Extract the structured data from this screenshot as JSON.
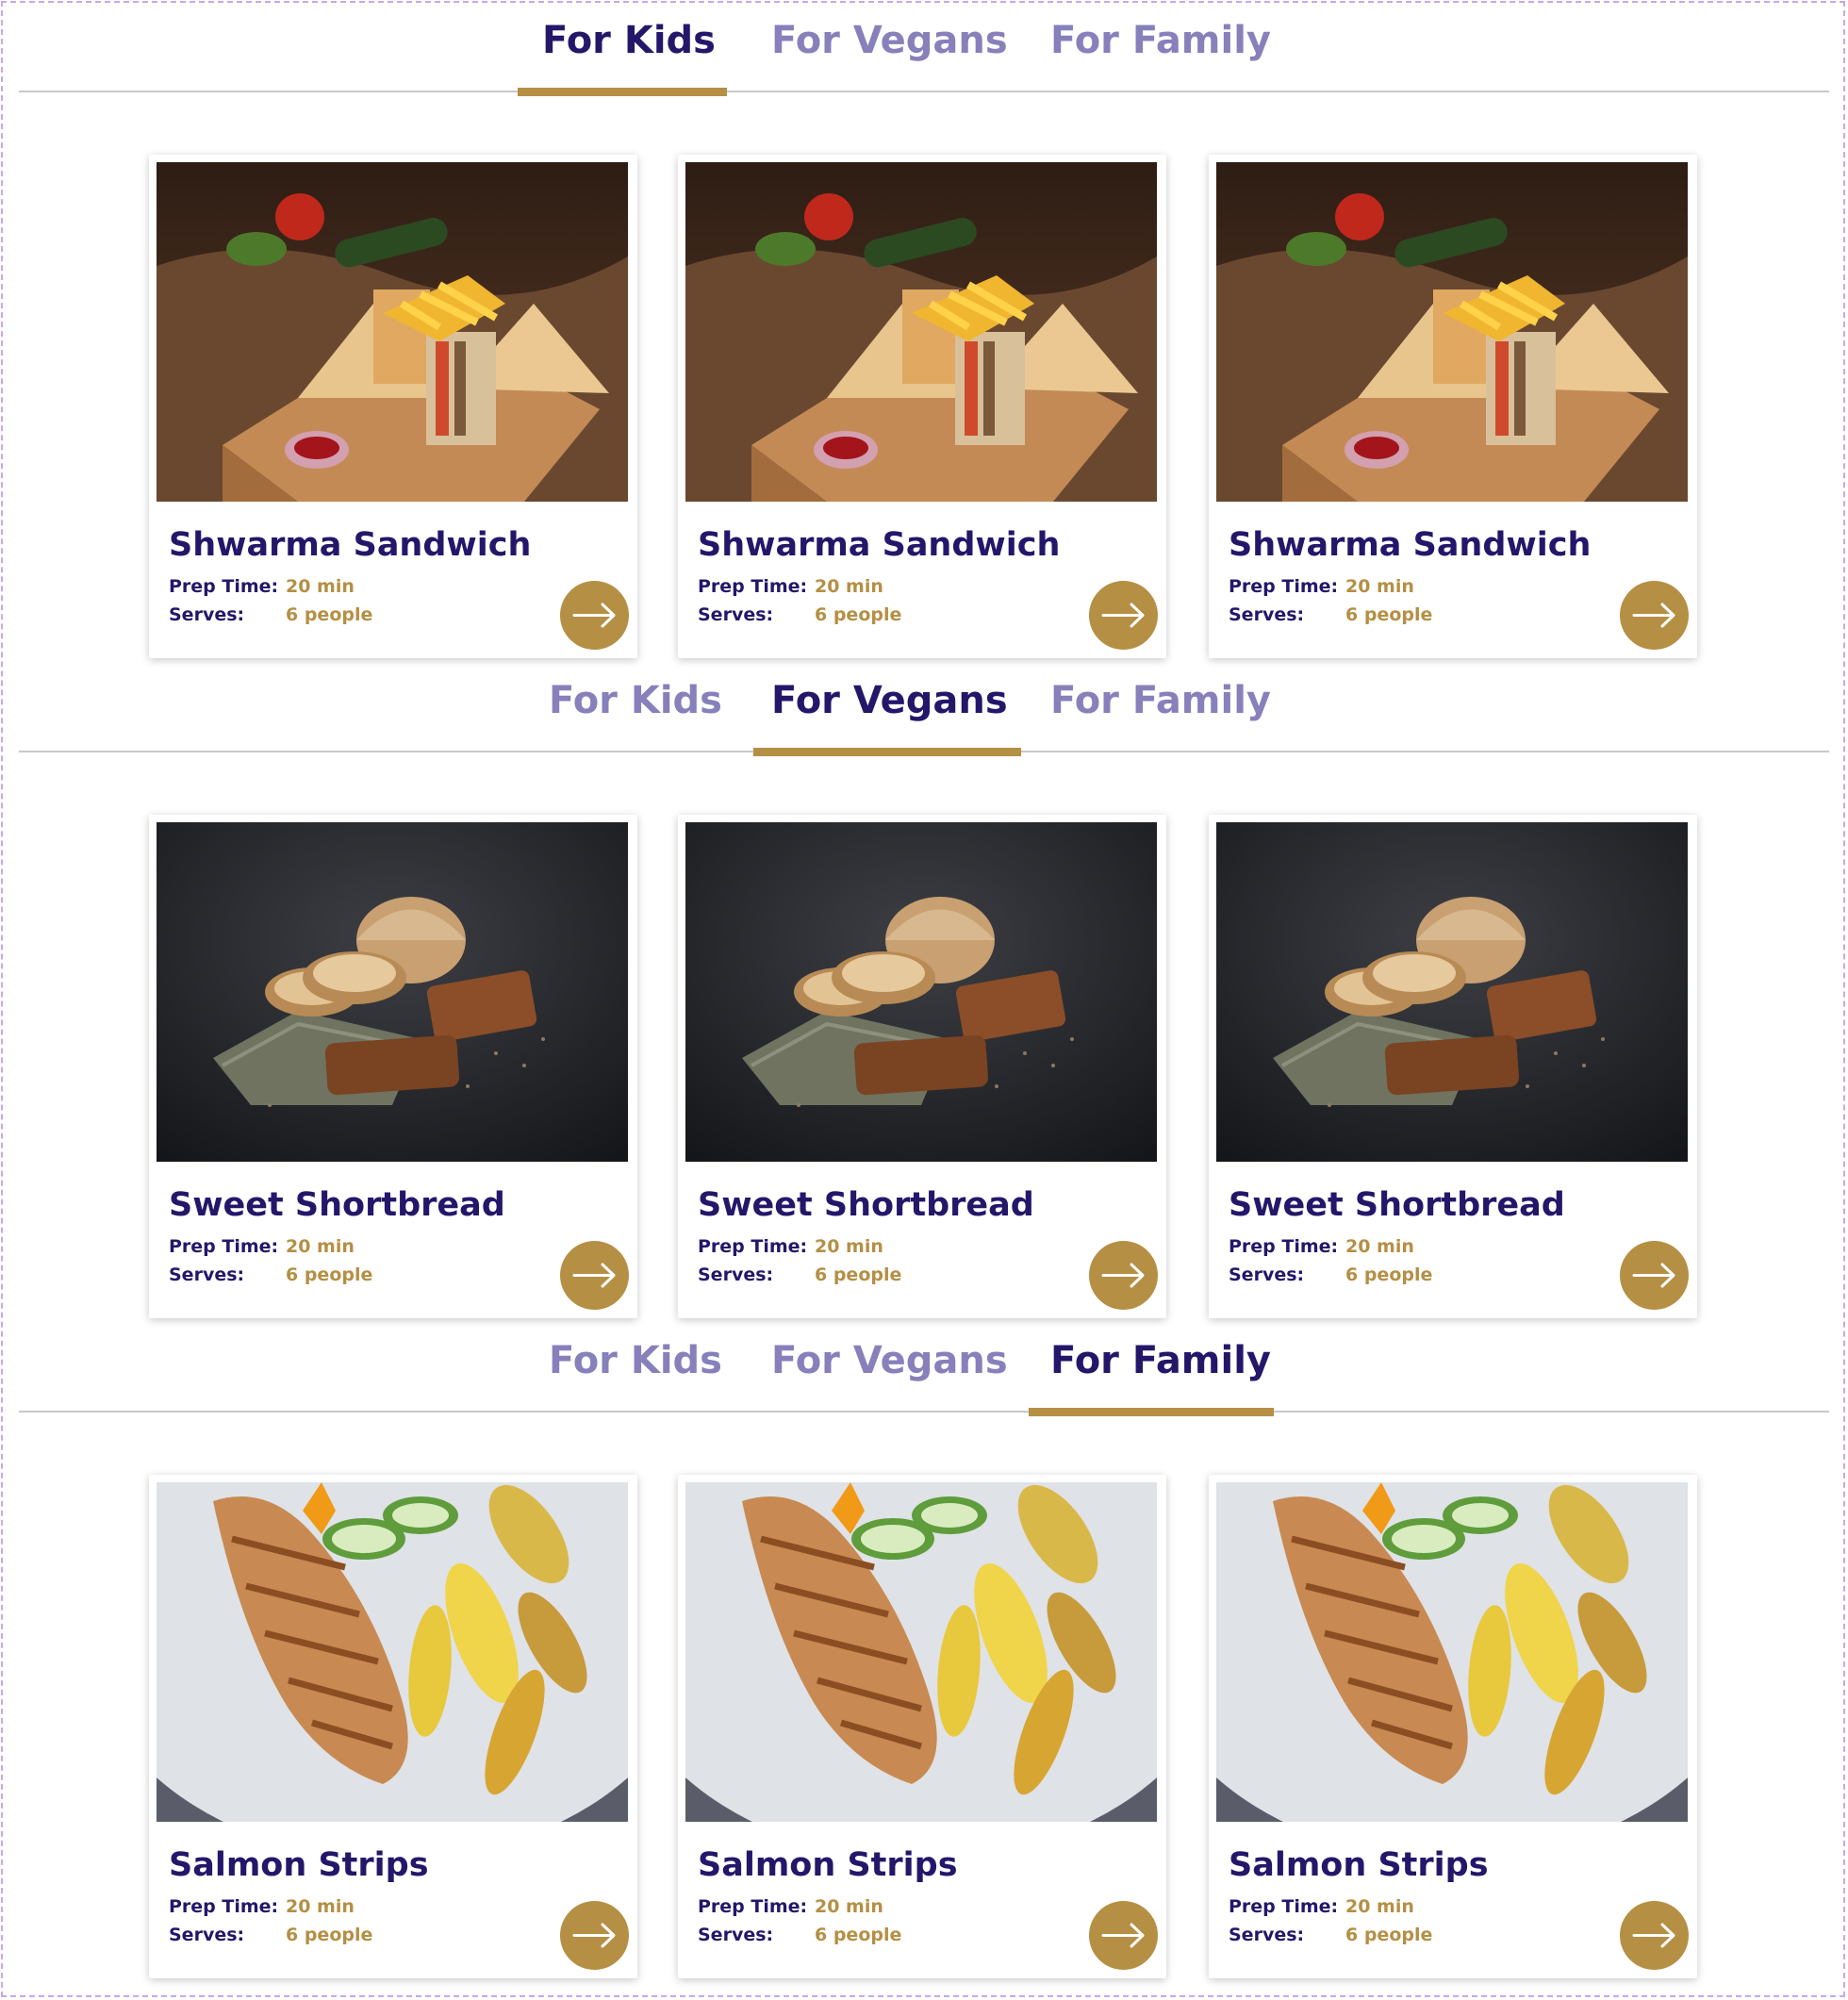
{
  "sections": [
    {
      "tabs": [
        {
          "label": "For Kids",
          "active": true
        },
        {
          "label": "For Vegans",
          "active": false
        },
        {
          "label": "For Family",
          "active": false
        }
      ],
      "cards": [
        {
          "title": "Shwarma Sandwich",
          "prep_label": "Prep Time:",
          "prep_value": "20 min",
          "serves_label": "Serves:",
          "serves_value": "6 people",
          "image": "sandwich-photo"
        },
        {
          "title": "Shwarma Sandwich",
          "prep_label": "Prep Time:",
          "prep_value": "20 min",
          "serves_label": "Serves:",
          "serves_value": "6 people",
          "image": "sandwich-photo"
        },
        {
          "title": "Shwarma Sandwich",
          "prep_label": "Prep Time:",
          "prep_value": "20 min",
          "serves_label": "Serves:",
          "serves_value": "6 people",
          "image": "sandwich-photo"
        }
      ]
    },
    {
      "tabs": [
        {
          "label": "For Kids",
          "active": false
        },
        {
          "label": "For Vegans",
          "active": true
        },
        {
          "label": "For Family",
          "active": false
        }
      ],
      "cards": [
        {
          "title": "Sweet Shortbread",
          "prep_label": "Prep Time:",
          "prep_value": "20 min",
          "serves_label": "Serves:",
          "serves_value": "6 people",
          "image": "bread-photo"
        },
        {
          "title": "Sweet Shortbread",
          "prep_label": "Prep Time:",
          "prep_value": "20 min",
          "serves_label": "Serves:",
          "serves_value": "6 people",
          "image": "bread-photo"
        },
        {
          "title": "Sweet Shortbread",
          "prep_label": "Prep Time:",
          "prep_value": "20 min",
          "serves_label": "Serves:",
          "serves_value": "6 people",
          "image": "bread-photo"
        }
      ]
    },
    {
      "tabs": [
        {
          "label": "For Kids",
          "active": false
        },
        {
          "label": "For Vegans",
          "active": false
        },
        {
          "label": "For Family",
          "active": true
        }
      ],
      "cards": [
        {
          "title": "Salmon Strips",
          "prep_label": "Prep Time:",
          "prep_value": "20 min",
          "serves_label": "Serves:",
          "serves_value": "6 people",
          "image": "grilled-plate-photo"
        },
        {
          "title": "Salmon Strips",
          "prep_label": "Prep Time:",
          "prep_value": "20 min",
          "serves_label": "Serves:",
          "serves_value": "6 people",
          "image": "grilled-plate-photo"
        },
        {
          "title": "Salmon Strips",
          "prep_label": "Prep Time:",
          "prep_value": "20 min",
          "serves_label": "Serves:",
          "serves_value": "6 people",
          "image": "grilled-plate-photo"
        }
      ]
    }
  ],
  "icons": {
    "card_button": "arrow-right-icon"
  },
  "colors": {
    "navy": "#24176a",
    "inactive_tab": "#8880bb",
    "gold": "#b58f44",
    "divider": "#c9c9c9",
    "frame_dash": "#c6a8ec"
  }
}
